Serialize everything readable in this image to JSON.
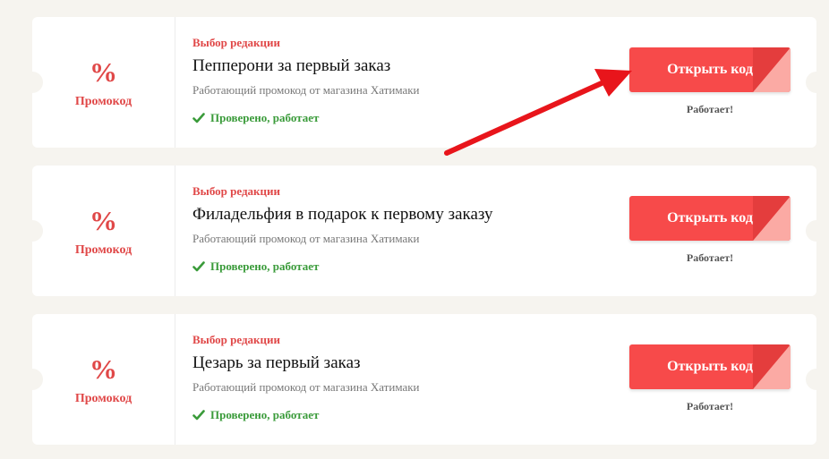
{
  "colors": {
    "accent": "#f74a4a",
    "accent_text": "#e04848",
    "verified": "#3a9b3a",
    "annotation_arrow": "#e8151b"
  },
  "coupons": [
    {
      "percent_sign": "%",
      "promo_label": "Промокод",
      "badge": "Выбор редакции",
      "title": "Пепперони за первый заказ",
      "subtitle": "Работающий промокод от магазина Хатимаки",
      "verified_icon": "check-icon",
      "verified_text": "Проверено, работает",
      "button_label": "Открыть код",
      "status": "Работает!"
    },
    {
      "percent_sign": "%",
      "promo_label": "Промокод",
      "badge": "Выбор редакции",
      "title": "Филадельфия в подарок к первому заказу",
      "subtitle": "Работающий промокод от магазина Хатимаки",
      "verified_icon": "check-icon",
      "verified_text": "Проверено, работает",
      "button_label": "Открыть код",
      "status": "Работает!"
    },
    {
      "percent_sign": "%",
      "promo_label": "Промокод",
      "badge": "Выбор редакции",
      "title": "Цезарь за первый заказ",
      "subtitle": "Работающий промокод от магазина Хатимаки",
      "verified_icon": "check-icon",
      "verified_text": "Проверено, работает",
      "button_label": "Открыть код",
      "status": "Работает!"
    }
  ]
}
